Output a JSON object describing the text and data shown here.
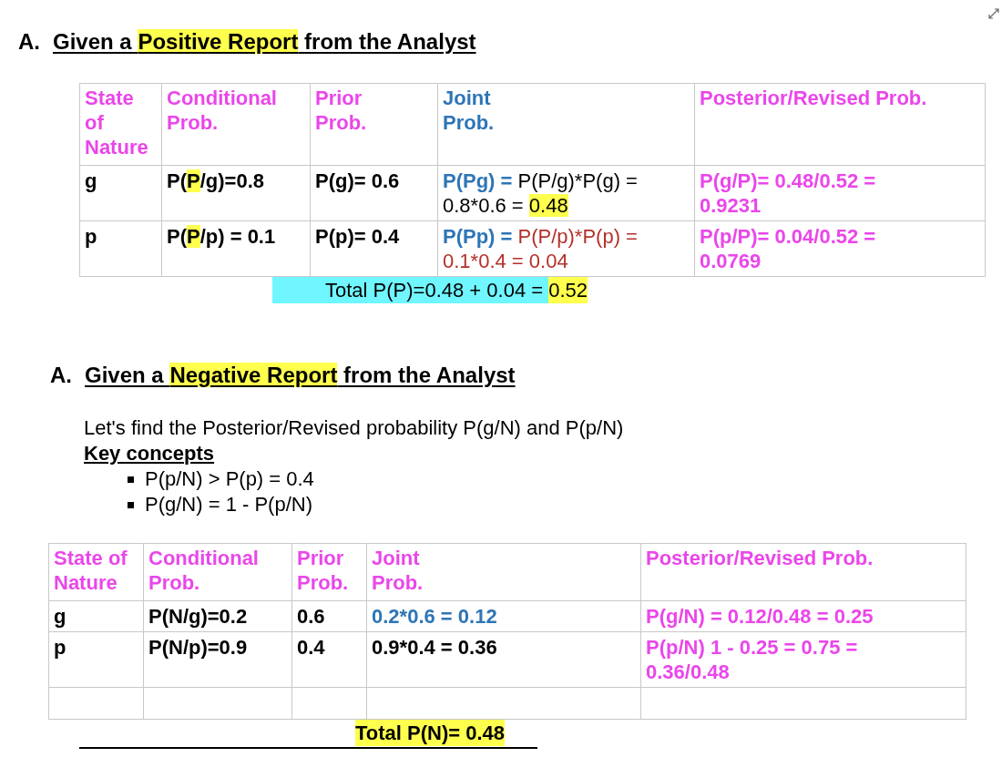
{
  "sections": [
    {
      "marker": "A.",
      "title": [
        {
          "text": "Given a "
        },
        {
          "text": "Positive Report",
          "highlight": {
            "color": "#ffff4d"
          }
        },
        {
          "text": " from the Analyst"
        }
      ],
      "table": {
        "trailing_blank_row": false,
        "header": [
          {
            "lines": [
              [
                {
                  "text": "State",
                  "color": "#ea46ea"
                }
              ],
              [
                {
                  "text": "of",
                  "color": "#ea46ea"
                }
              ],
              [
                {
                  "text": "Nature",
                  "color": "#ea46ea"
                }
              ]
            ]
          },
          {
            "lines": [
              [
                {
                  "text": "Conditional",
                  "color": "#ea46ea"
                }
              ],
              [
                {
                  "text": "Prob.",
                  "color": "#ea46ea"
                }
              ]
            ]
          },
          {
            "lines": [
              [
                {
                  "text": "Prior",
                  "color": "#ea46ea"
                }
              ],
              [
                {
                  "text": "Prob.",
                  "color": "#ea46ea"
                }
              ]
            ]
          },
          {
            "lines": [
              [
                {
                  "text": "Joint",
                  "color": "#2e75b6"
                }
              ],
              [
                {
                  "text": "Prob.",
                  "color": "#2e75b6"
                }
              ]
            ]
          },
          {
            "lines": [
              [
                {
                  "text": "Posterior/Revised Prob.",
                  "color": "#ea46ea"
                }
              ]
            ]
          }
        ],
        "rows": [
          [
            {
              "lines": [
                [
                  {
                    "text": "g",
                    "bold": true
                  }
                ]
              ]
            },
            {
              "lines": [
                [
                  {
                    "text": "P(",
                    "bold": true
                  },
                  {
                    "text": "P",
                    "bold": true,
                    "highlight": {
                      "color": "#ffff4d"
                    }
                  },
                  {
                    "text": "/g)=0.8",
                    "bold": true
                  }
                ]
              ]
            },
            {
              "lines": [
                [
                  {
                    "text": "P(g)= 0.6",
                    "bold": true
                  }
                ]
              ]
            },
            {
              "lines": [
                [
                  {
                    "text": "P(Pg) = ",
                    "bold": true,
                    "color": "#2e75b6"
                  },
                  {
                    "text": " P(P/g)*P(g) ="
                  }
                ],
                [
                  {
                    "text": "0.8*0.6 = "
                  },
                  {
                    "text": "0.48",
                    "highlight": {
                      "color": "#ffff4d"
                    }
                  }
                ]
              ]
            },
            {
              "lines": [
                [
                  {
                    "text": " P(g/P)= 0.48/0.52 =",
                    "bold": true,
                    "color": "#ea46ea"
                  }
                ],
                [
                  {
                    "text": "0.9231",
                    "bold": true,
                    "color": "#ea46ea"
                  }
                ]
              ]
            }
          ],
          [
            {
              "lines": [
                [
                  {
                    "text": "p",
                    "bold": true
                  }
                ]
              ]
            },
            {
              "lines": [
                [
                  {
                    "text": "P(",
                    "bold": true
                  },
                  {
                    "text": "P",
                    "bold": true,
                    "highlight": {
                      "color": "#ffff4d"
                    }
                  },
                  {
                    "text": "/p) = 0.1",
                    "bold": true
                  }
                ]
              ]
            },
            {
              "lines": [
                [
                  {
                    "text": "P(p)= 0.4",
                    "bold": true
                  }
                ]
              ]
            },
            {
              "lines": [
                [
                  {
                    "text": "P(Pp) = ",
                    "bold": true,
                    "color": "#2e75b6"
                  },
                  {
                    "text": " P(P/p)*P(p) =",
                    "color": "#b5302a"
                  }
                ],
                [
                  {
                    "text": "0.1*0.4 = 0.04",
                    "color": "#b5302a"
                  }
                ]
              ]
            },
            {
              "lines": [
                [
                  {
                    "text": " P(p/P)= 0.04/0.52 =",
                    "bold": true,
                    "color": "#ea46ea"
                  }
                ],
                [
                  {
                    "text": "0.0769",
                    "bold": true,
                    "color": "#ea46ea"
                  }
                ]
              ]
            }
          ]
        ]
      },
      "total": [
        {
          "text": "Total P(P)=0.48 + 0.04 = ",
          "highlight": {
            "color": "#6ff6ff"
          }
        },
        {
          "text": "0.52",
          "highlight": {
            "color": "#ffff4d"
          }
        }
      ]
    },
    {
      "marker": "A.",
      "title": [
        {
          "text": "Given a "
        },
        {
          "text": "Negative Report",
          "highlight": {
            "color": "#ffff4d"
          }
        },
        {
          "text": " from the Analyst"
        }
      ],
      "intro": "Let's find the Posterior/Revised probability P(g/N) and P(p/N)",
      "concepts_heading": "Key concepts",
      "concepts": [
        "P(p/N) > P(p) = 0.4",
        "P(g/N) = 1 - P(p/N)"
      ],
      "table": {
        "trailing_blank_row": true,
        "header": [
          {
            "lines": [
              [
                {
                  "text": "State of",
                  "color": "#ea46ea"
                }
              ],
              [
                {
                  "text": "Nature",
                  "color": "#ea46ea"
                }
              ]
            ]
          },
          {
            "lines": [
              [
                {
                  "text": "Conditional",
                  "color": "#ea46ea"
                }
              ],
              [
                {
                  "text": "Prob.",
                  "color": "#ea46ea"
                }
              ]
            ]
          },
          {
            "lines": [
              [
                {
                  "text": "Prior",
                  "color": "#ea46ea"
                }
              ],
              [
                {
                  "text": "Prob.",
                  "color": "#ea46ea"
                }
              ]
            ]
          },
          {
            "lines": [
              [
                {
                  "text": "Joint",
                  "color": "#ea46ea"
                }
              ],
              [
                {
                  "text": "Prob.",
                  "color": "#ea46ea"
                }
              ]
            ]
          },
          {
            "lines": [
              [
                {
                  "text": "Posterior/Revised Prob.",
                  "color": "#ea46ea"
                }
              ]
            ]
          }
        ],
        "rows": [
          [
            {
              "lines": [
                [
                  {
                    "text": "g",
                    "bold": true
                  }
                ]
              ]
            },
            {
              "lines": [
                [
                  {
                    "text": "P(N/g)=0.2",
                    "bold": true
                  }
                ]
              ]
            },
            {
              "lines": [
                [
                  {
                    "text": "0.6",
                    "bold": true
                  }
                ]
              ]
            },
            {
              "lines": [
                [
                  {
                    "text": "0.2*0.6 = 0.12",
                    "bold": true,
                    "color": "#2e75b6"
                  }
                ]
              ]
            },
            {
              "lines": [
                [
                  {
                    "text": "P(g/N) = 0.12/0.48 = 0.25",
                    "bold": true,
                    "color": "#ea46ea"
                  }
                ]
              ]
            }
          ],
          [
            {
              "lines": [
                [
                  {
                    "text": "p",
                    "bold": true
                  }
                ]
              ]
            },
            {
              "lines": [
                [
                  {
                    "text": "P(N/p)=0.9",
                    "bold": true
                  }
                ]
              ]
            },
            {
              "lines": [
                [
                  {
                    "text": "0.4",
                    "bold": true
                  }
                ]
              ]
            },
            {
              "lines": [
                [
                  {
                    "text": "0.9*0.4 = 0.36",
                    "bold": true
                  }
                ]
              ]
            },
            {
              "lines": [
                [
                  {
                    "text": " P(p/N) 1 - 0.25 = 0.75 =",
                    "bold": true,
                    "color": "#ea46ea"
                  }
                ],
                [
                  {
                    "text": "0.36/0.48",
                    "bold": true,
                    "color": "#ea46ea"
                  }
                ]
              ]
            }
          ]
        ]
      },
      "total": [
        {
          "text": "Total P(N)= 0.48",
          "bold": true,
          "highlight": {
            "color": "#ffff4d"
          }
        }
      ]
    }
  ]
}
